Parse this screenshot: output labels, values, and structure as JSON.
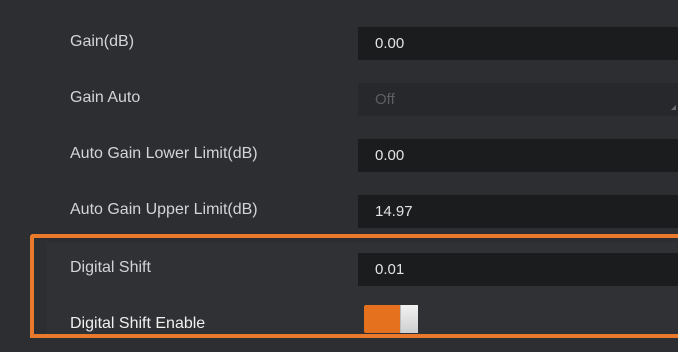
{
  "properties": [
    {
      "label": "Gain(dB)",
      "value": "0.00"
    },
    {
      "label": "Gain Auto",
      "value": "Off"
    },
    {
      "label": "Auto Gain Lower Limit(dB)",
      "value": "0.00"
    },
    {
      "label": "Auto Gain Upper Limit(dB)",
      "value": "14.97"
    },
    {
      "label": "Digital Shift",
      "value": "0.01"
    },
    {
      "label": "Digital Shift Enable",
      "toggle_on": true
    }
  ],
  "colors": {
    "highlight": "#e97a2c",
    "toggle_on": "#e5701e"
  }
}
